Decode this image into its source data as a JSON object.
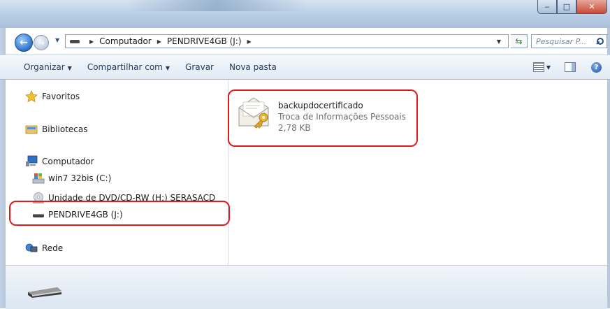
{
  "window": {
    "minimize_glyph": "‒",
    "maximize_glyph": "□",
    "close_glyph": "✕"
  },
  "navigation": {
    "back_glyph": "←",
    "forward_glyph": "→",
    "breadcrumb": [
      "Computador",
      "PENDRIVE4GB (J:)"
    ],
    "search_placeholder": "Pesquisar P..."
  },
  "toolbar": {
    "organize": "Organizar",
    "share": "Compartilhar com",
    "burn": "Gravar",
    "new_folder": "Nova pasta"
  },
  "sidebar": {
    "favorites": "Favoritos",
    "libraries": "Bibliotecas",
    "computer": "Computador",
    "drive_c": "win7 32bis (C:)",
    "drive_dvd": "Unidade de DVD/CD-RW (H:) SERASACD",
    "drive_usb": "PENDRIVE4GB (J:)",
    "network": "Rede"
  },
  "file": {
    "name": "backupdocertificado",
    "type": "Troca de Informações Pessoais",
    "size": "2,78 KB"
  },
  "colors": {
    "highlight": "#e01919",
    "toolbar_text": "#1e395b"
  }
}
